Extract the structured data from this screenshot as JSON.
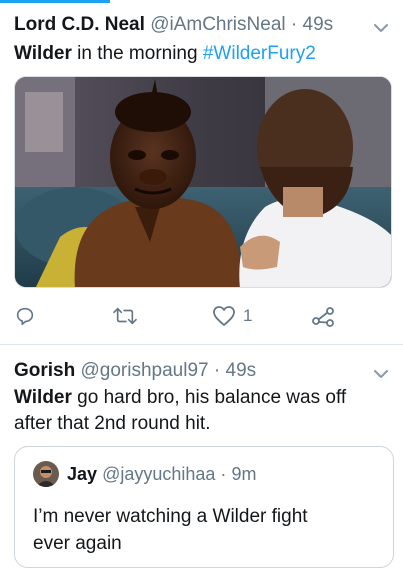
{
  "tweet1": {
    "name": "Lord C.D. Neal",
    "handle": "@iAmChrisNeal",
    "separator": "·",
    "time": "49s",
    "text_bold": "Wilder",
    "text_rest": " in the morning ",
    "hashtag": "#WilderFury2",
    "media_icon": "photo-man-in-mask-on-couch",
    "actions": {
      "reply_icon": "reply-icon",
      "retweet_icon": "retweet-icon",
      "like_icon": "heart-icon",
      "like_count": "1",
      "share_icon": "share-icon"
    }
  },
  "tweet2": {
    "name": "Gorish",
    "handle": "@gorishpaul97",
    "separator": "·",
    "time": "49s",
    "text_line1_bold": "Wilder",
    "text_line1_rest": " go hard bro, his balance was off",
    "text_line2": "after that 2nd round hit.",
    "quote": {
      "name": "Jay",
      "handle": "@jayyuchihaa",
      "separator": "·",
      "time": "9m",
      "text_line1": "I’m never watching a Wilder fight",
      "text_line2": "ever again"
    }
  },
  "colors": {
    "accent": "#1da1f2",
    "secondary_text": "#657786",
    "primary_text": "#14171a",
    "divider": "#e1e8ed"
  }
}
